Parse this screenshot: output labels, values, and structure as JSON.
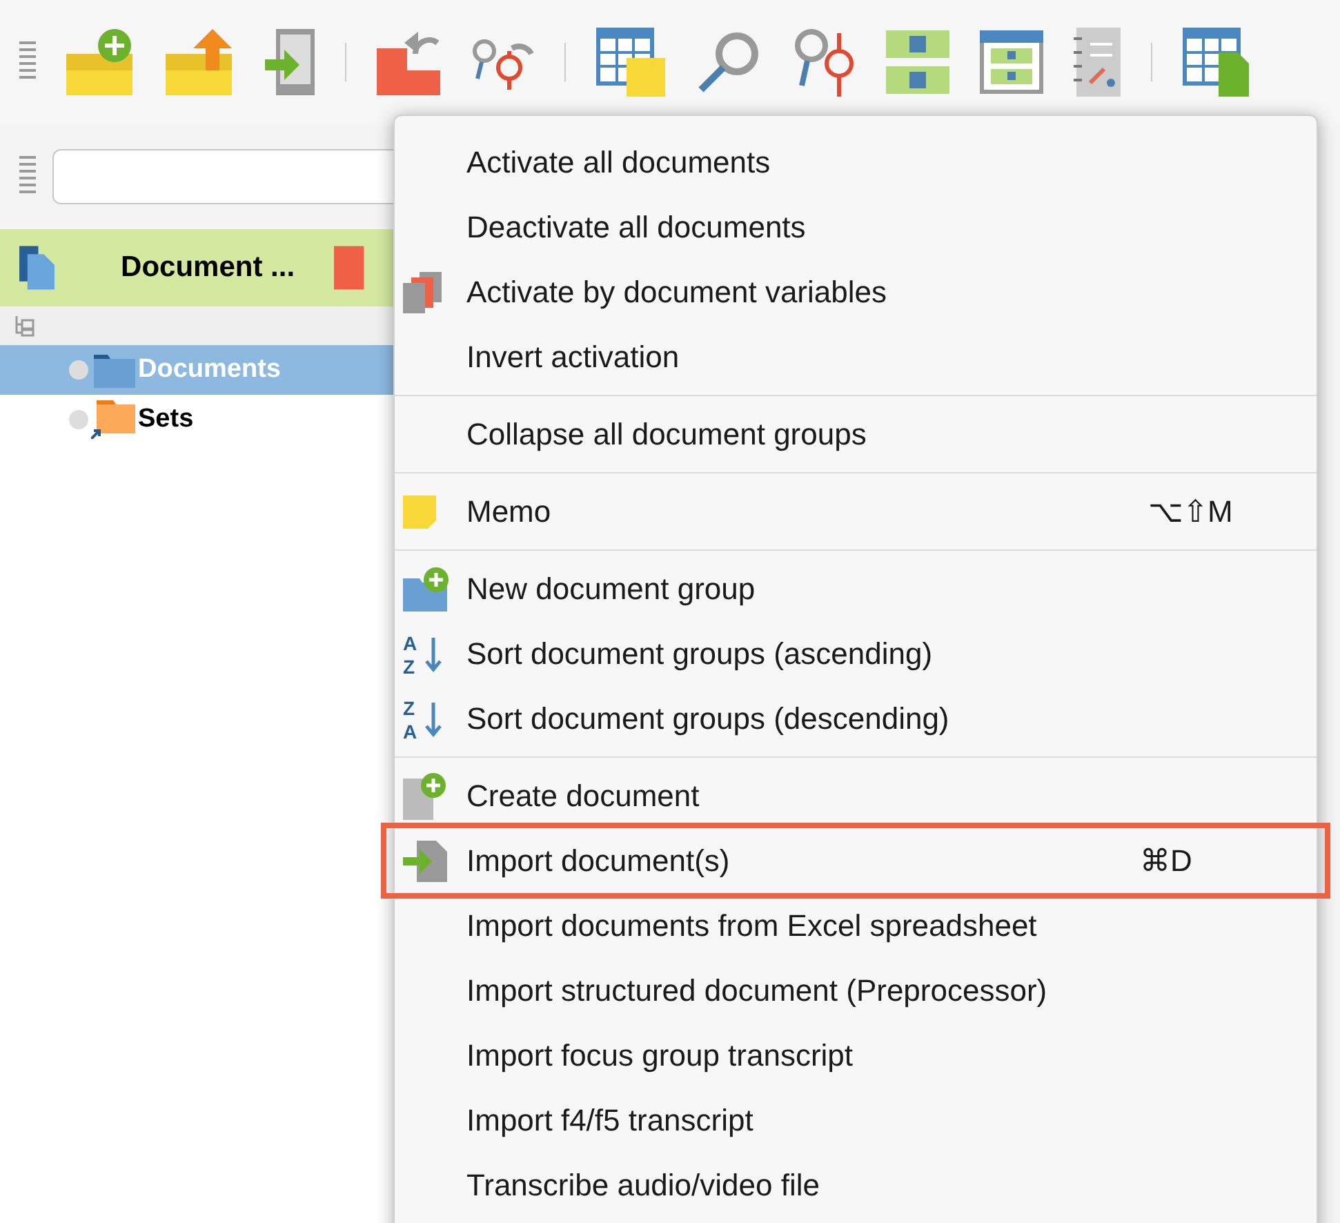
{
  "panel": {
    "title": "Document ..."
  },
  "tree": [
    {
      "label": "Documents",
      "selected": true
    },
    {
      "label": "Sets",
      "selected": false
    }
  ],
  "menu": [
    [
      {
        "label": "Activate all documents",
        "kind": "none",
        "highlighted": false
      },
      {
        "label": "Deactivate all documents",
        "kind": "none",
        "highlighted": false
      },
      {
        "label": "Activate by document variables",
        "kind": "variables",
        "highlighted": false
      },
      {
        "label": "Invert activation",
        "kind": "none",
        "highlighted": false
      }
    ],
    [
      {
        "label": "Collapse all document groups",
        "kind": "none",
        "highlighted": false
      }
    ],
    [
      {
        "label": "Memo",
        "kind": "memo",
        "shortcut": "⌥⇧M",
        "highlighted": false
      }
    ],
    [
      {
        "label": "New document group",
        "kind": "newgroup",
        "highlighted": false
      },
      {
        "label": "Sort document groups (ascending)",
        "kind": "sortasc",
        "icon_letters": [
          "A",
          "Z"
        ],
        "highlighted": false
      },
      {
        "label": "Sort document groups (descending)",
        "kind": "sortdesc",
        "icon_letters": [
          "Z",
          "A"
        ],
        "highlighted": false
      }
    ],
    [
      {
        "label": "Create document",
        "kind": "create",
        "highlighted": false
      },
      {
        "label": "Import document(s)",
        "kind": "import",
        "shortcut": "⌘D",
        "highlighted": true
      },
      {
        "label": "Import documents from Excel spreadsheet",
        "kind": "none",
        "highlighted": false
      },
      {
        "label": "Import structured document (Preprocessor)",
        "kind": "none",
        "highlighted": false
      },
      {
        "label": "Import focus group transcript",
        "kind": "none",
        "highlighted": false
      },
      {
        "label": "Import f4/f5 transcript",
        "kind": "none",
        "highlighted": false
      },
      {
        "label": "Transcribe audio/video file",
        "kind": "none",
        "highlighted": false
      }
    ]
  ]
}
